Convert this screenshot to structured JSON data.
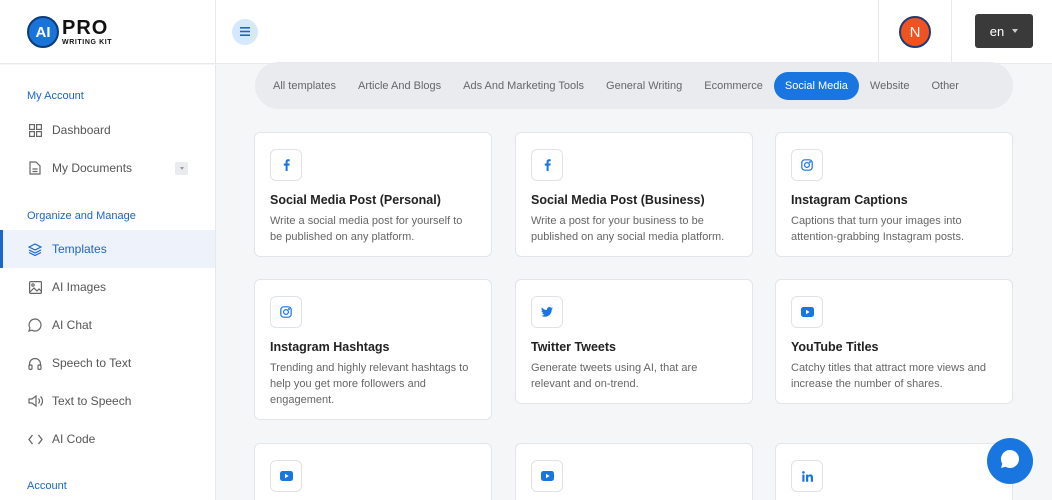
{
  "brand": {
    "logo_letters": "AI",
    "name": "PRO",
    "subtitle": "WRITING KIT"
  },
  "header": {
    "avatar_initial": "N",
    "language": "en"
  },
  "sidebar": {
    "sections": [
      "My Account",
      "Organize and Manage",
      "Account"
    ],
    "items": [
      {
        "label": "Dashboard",
        "icon": "grid-icon"
      },
      {
        "label": "My Documents",
        "icon": "document-icon"
      },
      {
        "label": "Templates",
        "icon": "layers-icon",
        "active": true
      },
      {
        "label": "AI Images",
        "icon": "image-icon"
      },
      {
        "label": "AI Chat",
        "icon": "chat-icon"
      },
      {
        "label": "Speech to Text",
        "icon": "headphones-icon"
      },
      {
        "label": "Text to Speech",
        "icon": "speaker-icon"
      },
      {
        "label": "AI Code",
        "icon": "code-icon"
      }
    ]
  },
  "tabs": [
    {
      "label": "All templates"
    },
    {
      "label": "Article And Blogs"
    },
    {
      "label": "Ads And Marketing Tools"
    },
    {
      "label": "General Writing"
    },
    {
      "label": "Ecommerce"
    },
    {
      "label": "Social Media",
      "active": true
    },
    {
      "label": "Website"
    },
    {
      "label": "Other"
    }
  ],
  "cards": [
    {
      "title": "Social Media Post (Personal)",
      "desc": "Write a social media post for yourself to be published on any platform.",
      "icon": "facebook-icon"
    },
    {
      "title": "Social Media Post (Business)",
      "desc": "Write a post for your business to be published on any social media platform.",
      "icon": "facebook-icon"
    },
    {
      "title": "Instagram Captions",
      "desc": "Captions that turn your images into attention-grabbing Instagram posts.",
      "icon": "instagram-icon"
    },
    {
      "title": "Instagram Hashtags",
      "desc": "Trending and highly relevant hashtags to help you get more followers and engagement.",
      "icon": "instagram-icon"
    },
    {
      "title": "Twitter Tweets",
      "desc": "Generate tweets using AI, that are relevant and on-trend.",
      "icon": "twitter-icon"
    },
    {
      "title": "YouTube Titles",
      "desc": "Catchy titles that attract more views and increase the number of shares.",
      "icon": "youtube-icon"
    },
    {
      "title": "",
      "desc": "",
      "icon": "youtube-icon"
    },
    {
      "title": "",
      "desc": "",
      "icon": "youtube-icon"
    },
    {
      "title": "",
      "desc": "",
      "icon": "linkedin-icon"
    }
  ],
  "colors": {
    "accent": "#1976e1",
    "sidebar_section": "#1a66c9",
    "avatar": "#f0531f"
  }
}
